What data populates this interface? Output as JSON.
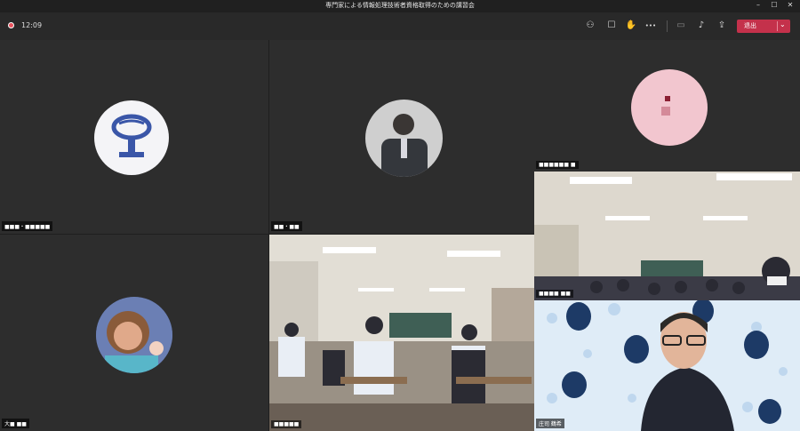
{
  "window": {
    "title": "専門家による情報処理技術者資格取得のための講習会",
    "controls": {
      "minimize": "–",
      "maximize": "☐",
      "close": "✕"
    }
  },
  "toolbar": {
    "timer": "12:09",
    "icons": {
      "participants": "⚇",
      "chat": "☐",
      "raise_hand": "✋",
      "more": "•••",
      "camera": "▭",
      "mic": "♪",
      "share": "⇪"
    },
    "leave_label": "退出",
    "leave_chevron": "⌄"
  },
  "participants": [
    {
      "label": "■■■・■■■■■"
    },
    {
      "label": "■■・■■"
    },
    {
      "label": "■■■■■■ ■"
    },
    {
      "label": "■■■■ ■■"
    },
    {
      "label": "大■ ■■"
    },
    {
      "label": "■■■■■"
    },
    {
      "label": "庄司 鶴希"
    }
  ]
}
